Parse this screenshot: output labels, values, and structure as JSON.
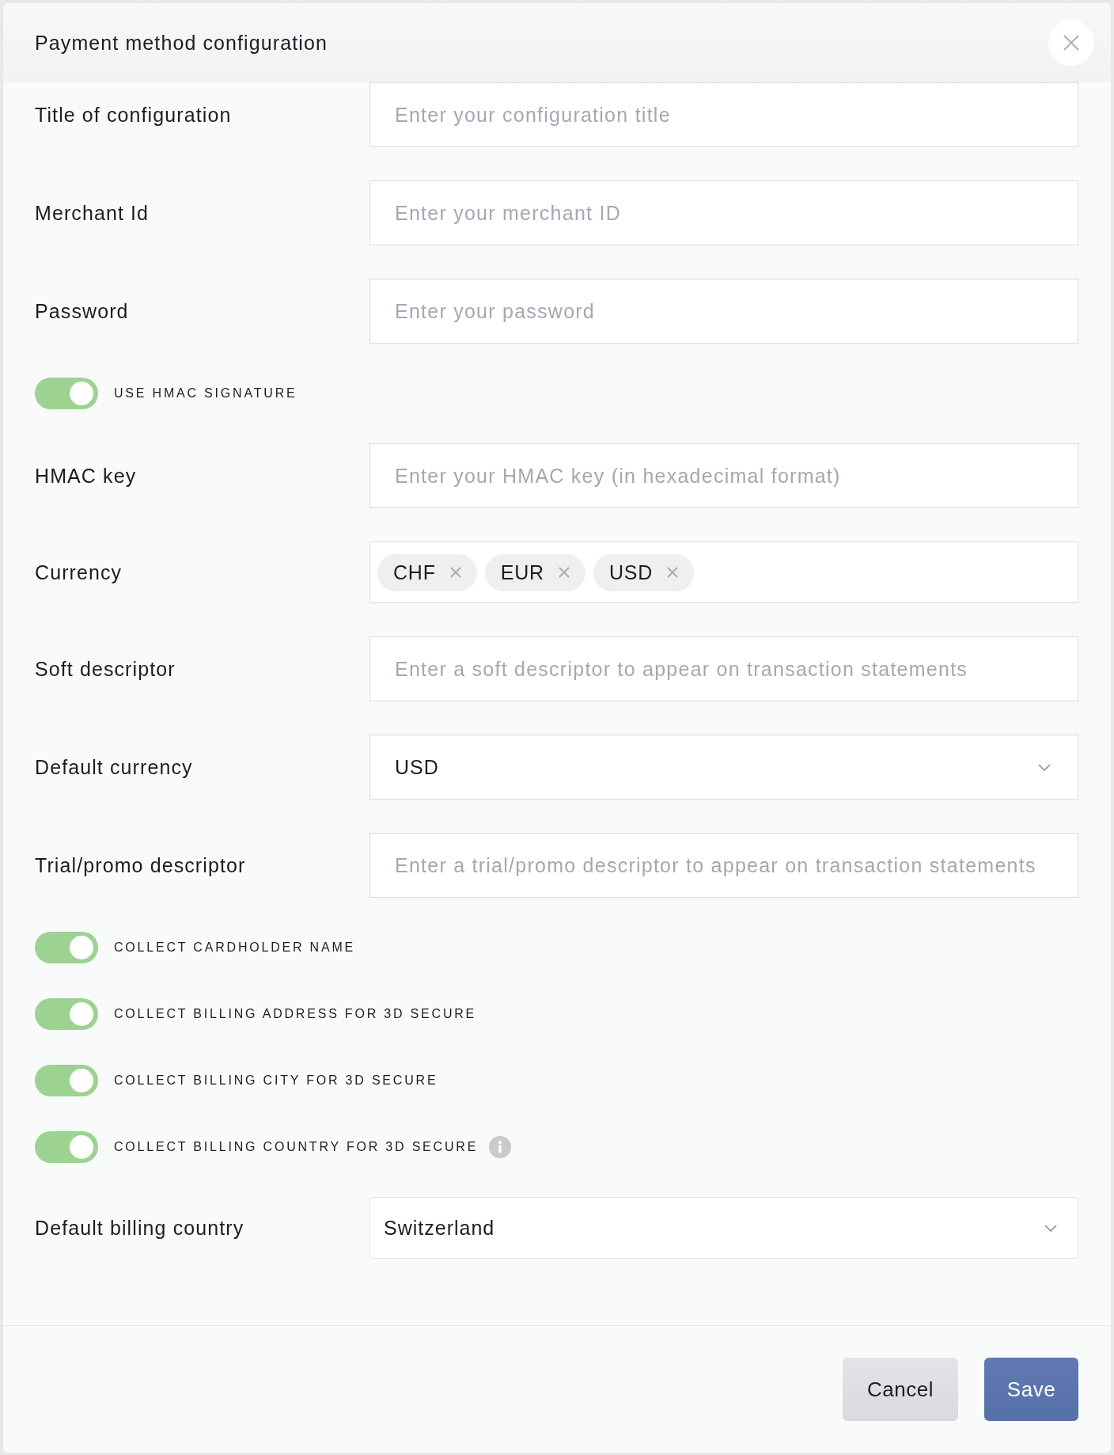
{
  "dialog": {
    "title": "Payment method configuration"
  },
  "fields": [
    {
      "kind": "text",
      "label": "Title of configuration",
      "placeholder": "Enter your configuration title"
    },
    {
      "kind": "text",
      "label": "Merchant Id",
      "placeholder": "Enter your merchant ID"
    },
    {
      "kind": "text",
      "label": "Password",
      "placeholder": "Enter your password"
    },
    {
      "kind": "toggle",
      "label": "USE HMAC SIGNATURE",
      "on": true
    },
    {
      "kind": "text",
      "label": "HMAC key",
      "placeholder": "Enter your HMAC key (in hexadecimal format)"
    },
    {
      "kind": "tags",
      "label": "Currency",
      "tags": [
        "CHF",
        "EUR",
        "USD"
      ]
    },
    {
      "kind": "text",
      "label": "Soft descriptor",
      "placeholder": "Enter a soft descriptor to appear on transaction statements"
    },
    {
      "kind": "select",
      "label": "Default currency",
      "value": "USD"
    },
    {
      "kind": "text",
      "label": "Trial/promo descriptor",
      "placeholder": "Enter a trial/promo descriptor to appear on transaction statements"
    },
    {
      "kind": "toggle",
      "label": "COLLECT CARDHOLDER NAME",
      "on": true
    },
    {
      "kind": "toggle",
      "label": "COLLECT BILLING ADDRESS FOR 3D SECURE",
      "on": true
    },
    {
      "kind": "toggle",
      "label": "COLLECT BILLING CITY FOR 3D SECURE",
      "on": true
    },
    {
      "kind": "toggle",
      "label": "COLLECT BILLING COUNTRY FOR 3D SECURE",
      "on": true,
      "info": true
    },
    {
      "kind": "select",
      "label": "Default billing country",
      "value": "Switzerland"
    }
  ],
  "buttons": [
    {
      "kind": "secondary",
      "label": "Cancel"
    },
    {
      "kind": "primary",
      "label": "Save"
    }
  ]
}
